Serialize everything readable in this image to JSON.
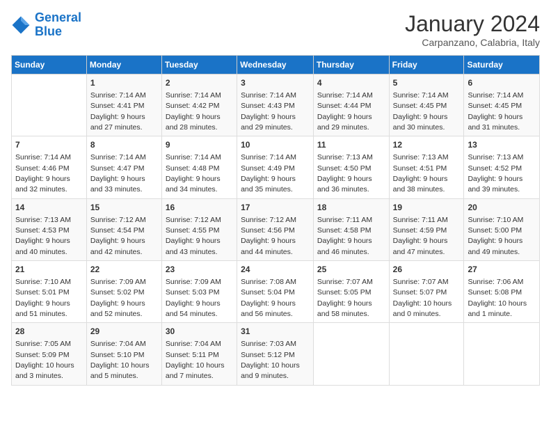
{
  "header": {
    "logo_line1": "General",
    "logo_line2": "Blue",
    "month": "January 2024",
    "location": "Carpanzano, Calabria, Italy"
  },
  "weekdays": [
    "Sunday",
    "Monday",
    "Tuesday",
    "Wednesday",
    "Thursday",
    "Friday",
    "Saturday"
  ],
  "weeks": [
    [
      {
        "day": "",
        "sunrise": "",
        "sunset": "",
        "daylight": ""
      },
      {
        "day": "1",
        "sunrise": "Sunrise: 7:14 AM",
        "sunset": "Sunset: 4:41 PM",
        "daylight": "Daylight: 9 hours and 27 minutes."
      },
      {
        "day": "2",
        "sunrise": "Sunrise: 7:14 AM",
        "sunset": "Sunset: 4:42 PM",
        "daylight": "Daylight: 9 hours and 28 minutes."
      },
      {
        "day": "3",
        "sunrise": "Sunrise: 7:14 AM",
        "sunset": "Sunset: 4:43 PM",
        "daylight": "Daylight: 9 hours and 29 minutes."
      },
      {
        "day": "4",
        "sunrise": "Sunrise: 7:14 AM",
        "sunset": "Sunset: 4:44 PM",
        "daylight": "Daylight: 9 hours and 29 minutes."
      },
      {
        "day": "5",
        "sunrise": "Sunrise: 7:14 AM",
        "sunset": "Sunset: 4:45 PM",
        "daylight": "Daylight: 9 hours and 30 minutes."
      },
      {
        "day": "6",
        "sunrise": "Sunrise: 7:14 AM",
        "sunset": "Sunset: 4:45 PM",
        "daylight": "Daylight: 9 hours and 31 minutes."
      }
    ],
    [
      {
        "day": "7",
        "sunrise": "Sunrise: 7:14 AM",
        "sunset": "Sunset: 4:46 PM",
        "daylight": "Daylight: 9 hours and 32 minutes."
      },
      {
        "day": "8",
        "sunrise": "Sunrise: 7:14 AM",
        "sunset": "Sunset: 4:47 PM",
        "daylight": "Daylight: 9 hours and 33 minutes."
      },
      {
        "day": "9",
        "sunrise": "Sunrise: 7:14 AM",
        "sunset": "Sunset: 4:48 PM",
        "daylight": "Daylight: 9 hours and 34 minutes."
      },
      {
        "day": "10",
        "sunrise": "Sunrise: 7:14 AM",
        "sunset": "Sunset: 4:49 PM",
        "daylight": "Daylight: 9 hours and 35 minutes."
      },
      {
        "day": "11",
        "sunrise": "Sunrise: 7:13 AM",
        "sunset": "Sunset: 4:50 PM",
        "daylight": "Daylight: 9 hours and 36 minutes."
      },
      {
        "day": "12",
        "sunrise": "Sunrise: 7:13 AM",
        "sunset": "Sunset: 4:51 PM",
        "daylight": "Daylight: 9 hours and 38 minutes."
      },
      {
        "day": "13",
        "sunrise": "Sunrise: 7:13 AM",
        "sunset": "Sunset: 4:52 PM",
        "daylight": "Daylight: 9 hours and 39 minutes."
      }
    ],
    [
      {
        "day": "14",
        "sunrise": "Sunrise: 7:13 AM",
        "sunset": "Sunset: 4:53 PM",
        "daylight": "Daylight: 9 hours and 40 minutes."
      },
      {
        "day": "15",
        "sunrise": "Sunrise: 7:12 AM",
        "sunset": "Sunset: 4:54 PM",
        "daylight": "Daylight: 9 hours and 42 minutes."
      },
      {
        "day": "16",
        "sunrise": "Sunrise: 7:12 AM",
        "sunset": "Sunset: 4:55 PM",
        "daylight": "Daylight: 9 hours and 43 minutes."
      },
      {
        "day": "17",
        "sunrise": "Sunrise: 7:12 AM",
        "sunset": "Sunset: 4:56 PM",
        "daylight": "Daylight: 9 hours and 44 minutes."
      },
      {
        "day": "18",
        "sunrise": "Sunrise: 7:11 AM",
        "sunset": "Sunset: 4:58 PM",
        "daylight": "Daylight: 9 hours and 46 minutes."
      },
      {
        "day": "19",
        "sunrise": "Sunrise: 7:11 AM",
        "sunset": "Sunset: 4:59 PM",
        "daylight": "Daylight: 9 hours and 47 minutes."
      },
      {
        "day": "20",
        "sunrise": "Sunrise: 7:10 AM",
        "sunset": "Sunset: 5:00 PM",
        "daylight": "Daylight: 9 hours and 49 minutes."
      }
    ],
    [
      {
        "day": "21",
        "sunrise": "Sunrise: 7:10 AM",
        "sunset": "Sunset: 5:01 PM",
        "daylight": "Daylight: 9 hours and 51 minutes."
      },
      {
        "day": "22",
        "sunrise": "Sunrise: 7:09 AM",
        "sunset": "Sunset: 5:02 PM",
        "daylight": "Daylight: 9 hours and 52 minutes."
      },
      {
        "day": "23",
        "sunrise": "Sunrise: 7:09 AM",
        "sunset": "Sunset: 5:03 PM",
        "daylight": "Daylight: 9 hours and 54 minutes."
      },
      {
        "day": "24",
        "sunrise": "Sunrise: 7:08 AM",
        "sunset": "Sunset: 5:04 PM",
        "daylight": "Daylight: 9 hours and 56 minutes."
      },
      {
        "day": "25",
        "sunrise": "Sunrise: 7:07 AM",
        "sunset": "Sunset: 5:05 PM",
        "daylight": "Daylight: 9 hours and 58 minutes."
      },
      {
        "day": "26",
        "sunrise": "Sunrise: 7:07 AM",
        "sunset": "Sunset: 5:07 PM",
        "daylight": "Daylight: 10 hours and 0 minutes."
      },
      {
        "day": "27",
        "sunrise": "Sunrise: 7:06 AM",
        "sunset": "Sunset: 5:08 PM",
        "daylight": "Daylight: 10 hours and 1 minute."
      }
    ],
    [
      {
        "day": "28",
        "sunrise": "Sunrise: 7:05 AM",
        "sunset": "Sunset: 5:09 PM",
        "daylight": "Daylight: 10 hours and 3 minutes."
      },
      {
        "day": "29",
        "sunrise": "Sunrise: 7:04 AM",
        "sunset": "Sunset: 5:10 PM",
        "daylight": "Daylight: 10 hours and 5 minutes."
      },
      {
        "day": "30",
        "sunrise": "Sunrise: 7:04 AM",
        "sunset": "Sunset: 5:11 PM",
        "daylight": "Daylight: 10 hours and 7 minutes."
      },
      {
        "day": "31",
        "sunrise": "Sunrise: 7:03 AM",
        "sunset": "Sunset: 5:12 PM",
        "daylight": "Daylight: 10 hours and 9 minutes."
      },
      {
        "day": "",
        "sunrise": "",
        "sunset": "",
        "daylight": ""
      },
      {
        "day": "",
        "sunrise": "",
        "sunset": "",
        "daylight": ""
      },
      {
        "day": "",
        "sunrise": "",
        "sunset": "",
        "daylight": ""
      }
    ]
  ]
}
